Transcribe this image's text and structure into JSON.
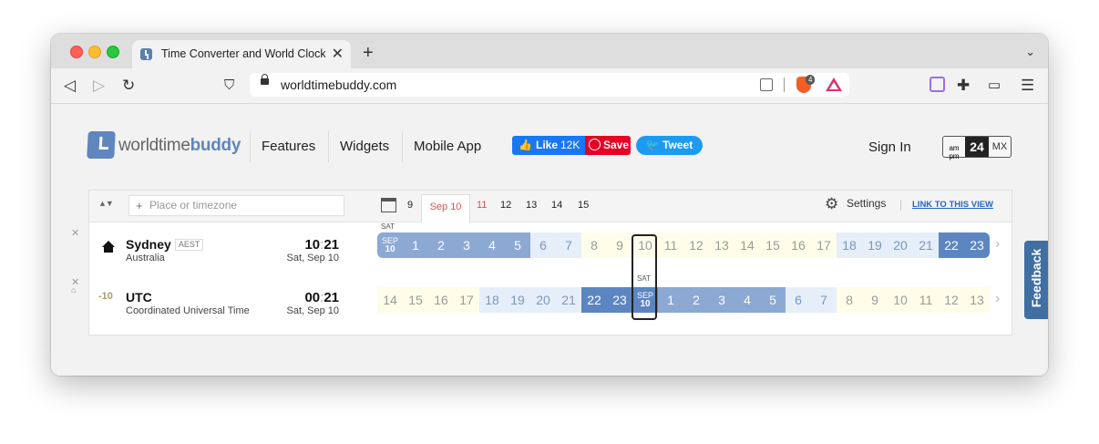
{
  "browser": {
    "tab_title": "Time Converter and World Clock",
    "url": "worldtimebuddy.com",
    "brave_badge": "4"
  },
  "site": {
    "logo_world": "worldtime",
    "logo_buddy": "buddy",
    "nav": [
      "Features",
      "Widgets",
      "Mobile App"
    ],
    "fb_label": "Like",
    "fb_count": "12K",
    "pin_label": "Save",
    "tweet_label": "Tweet",
    "signin": "Sign In",
    "fmt_ampm_top": "am",
    "fmt_ampm_bottom": "pm",
    "fmt_24": "24",
    "fmt_mx": "MX",
    "feedback": "Feedback"
  },
  "controls": {
    "search_placeholder": "Place or timezone",
    "days": [
      "9",
      "Sep 10",
      "11",
      "12",
      "13",
      "14",
      "15"
    ],
    "settings": "Settings",
    "link_view": "LINK TO THIS VIEW"
  },
  "rows": [
    {
      "city": "Sydney",
      "abbr": "AEST",
      "country": "Australia",
      "time_h": "10",
      "time_m": "21",
      "date": "Sat, Sep 10",
      "offset": "",
      "day_tag": "SAT",
      "hours": [
        "SEP|10",
        "1",
        "2",
        "3",
        "4",
        "5",
        "6",
        "7",
        "8",
        "9",
        "10",
        "11",
        "12",
        "13",
        "14",
        "15",
        "16",
        "17",
        "18",
        "19",
        "20",
        "21",
        "22",
        "23"
      ]
    },
    {
      "city": "UTC",
      "abbr": "",
      "country": "Coordinated Universal Time",
      "time_h": "00",
      "time_m": "21",
      "date": "Sat, Sep 10",
      "offset": "-10",
      "day_tag": "SAT",
      "hours": [
        "14",
        "15",
        "16",
        "17",
        "18",
        "19",
        "20",
        "21",
        "22",
        "23",
        "SEP|10",
        "1",
        "2",
        "3",
        "4",
        "5",
        "6",
        "7",
        "8",
        "9",
        "10",
        "11",
        "12",
        "13"
      ]
    }
  ],
  "colors": {
    "night": "#8ba9d3",
    "late": "#5c86c2",
    "dawn": "#e6eff9",
    "day": "#fdfde9",
    "brand": "#5f86bd"
  }
}
